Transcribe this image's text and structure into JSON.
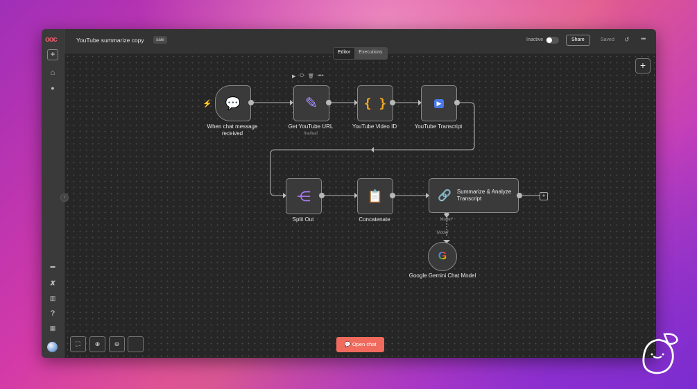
{
  "app": {
    "logo_text": "ᴏᴏᴄ",
    "workflow_title": "YouTube summarize copy",
    "tag": "sale"
  },
  "tabs": [
    {
      "label": "Editor",
      "active": true
    },
    {
      "label": "Executions",
      "active": false
    }
  ],
  "header": {
    "status_label": "Inactive",
    "share_label": "Share",
    "saved_label": "Saved",
    "history_icon": "↺",
    "more_icon": "•••"
  },
  "sidebar": {
    "add_icon": "+",
    "items": [
      {
        "icon": "home-icon",
        "glyph": "⌂"
      },
      {
        "icon": "user-icon",
        "glyph": "●"
      },
      {
        "icon": "templates-icon",
        "glyph": "▬"
      },
      {
        "icon": "variables-icon",
        "glyph": "𝒙"
      },
      {
        "icon": "insights-icon",
        "glyph": "▥"
      },
      {
        "icon": "help-icon",
        "glyph": "?"
      },
      {
        "icon": "whats-new-icon",
        "glyph": "▦"
      }
    ],
    "collapse_icon": "›"
  },
  "canvas": {
    "add_node_icon": "+",
    "node_toolbar": [
      "▶",
      "⏻",
      "🗑",
      "•••"
    ],
    "nodes": [
      {
        "id": "chat",
        "label": "When chat message received",
        "glyph": "💬"
      },
      {
        "id": "get_url",
        "label": "Get YouTube URL",
        "sublabel": "manual",
        "glyph": "✎"
      },
      {
        "id": "video_id",
        "label": "YouTube Video ID",
        "glyph": "{ }"
      },
      {
        "id": "transcript",
        "label": "YouTube Transcript",
        "glyph": "▶"
      },
      {
        "id": "split",
        "label": "Split Out",
        "glyph": "⋲"
      },
      {
        "id": "concat",
        "label": "Concatenate",
        "glyph": "📋"
      },
      {
        "id": "summarize",
        "label": "Summarize & Analyze Transcript",
        "glyph": "🔗"
      },
      {
        "id": "gemini",
        "label": "Google Gemini Chat Model",
        "glyph": "G"
      }
    ],
    "model_port_label": "Model*",
    "model_link_label": "Model",
    "end_plus": "+"
  },
  "controls": {
    "fit_icon": "⛶",
    "zoom_in_icon": "⊕",
    "zoom_out_icon": "⊖",
    "open_chat_label": "Open chat",
    "open_chat_icon": "💬"
  },
  "colors": {
    "accent": "#f06a5d",
    "node_border": "#8a8a8a",
    "canvas_bg": "#262626",
    "trigger_bolt": "#ff6b35"
  }
}
